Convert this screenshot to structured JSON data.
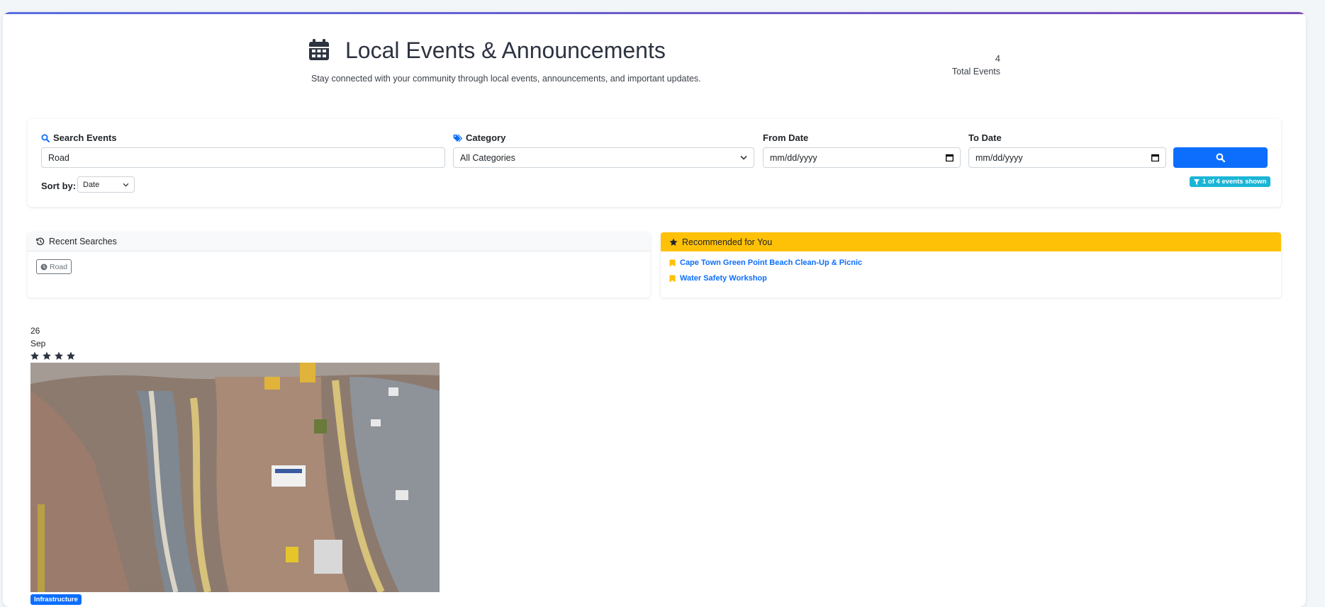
{
  "header": {
    "title": "Local Events & Announcements",
    "subtitle": "Stay connected with your community through local events, announcements, and important updates.",
    "stat_value": "4",
    "stat_label": "Total Events"
  },
  "filters": {
    "search_label": "Search Events",
    "search_value": "Road",
    "category_label": "Category",
    "category_value": "All Categories",
    "from_label": "From Date",
    "from_value": "mm/dd/yyyy",
    "to_label": "To Date",
    "to_value": "mm/dd/yyyy",
    "sort_label": "Sort by:",
    "sort_value": "Date",
    "results_badge": "1 of 4 events shown"
  },
  "recent": {
    "title": "Recent Searches",
    "items": [
      "Road"
    ]
  },
  "recommended": {
    "title": "Recommended for You",
    "items": [
      "Cape Town Green Point Beach Clean-Up & Picnic",
      "Water Safety Workshop"
    ]
  },
  "event": {
    "day": "26",
    "month": "Sep",
    "stars": 4,
    "category": "Infrastructure"
  },
  "colors": {
    "primary": "#0d6efd",
    "warning": "#ffc107",
    "info": "#1bb5d6"
  }
}
